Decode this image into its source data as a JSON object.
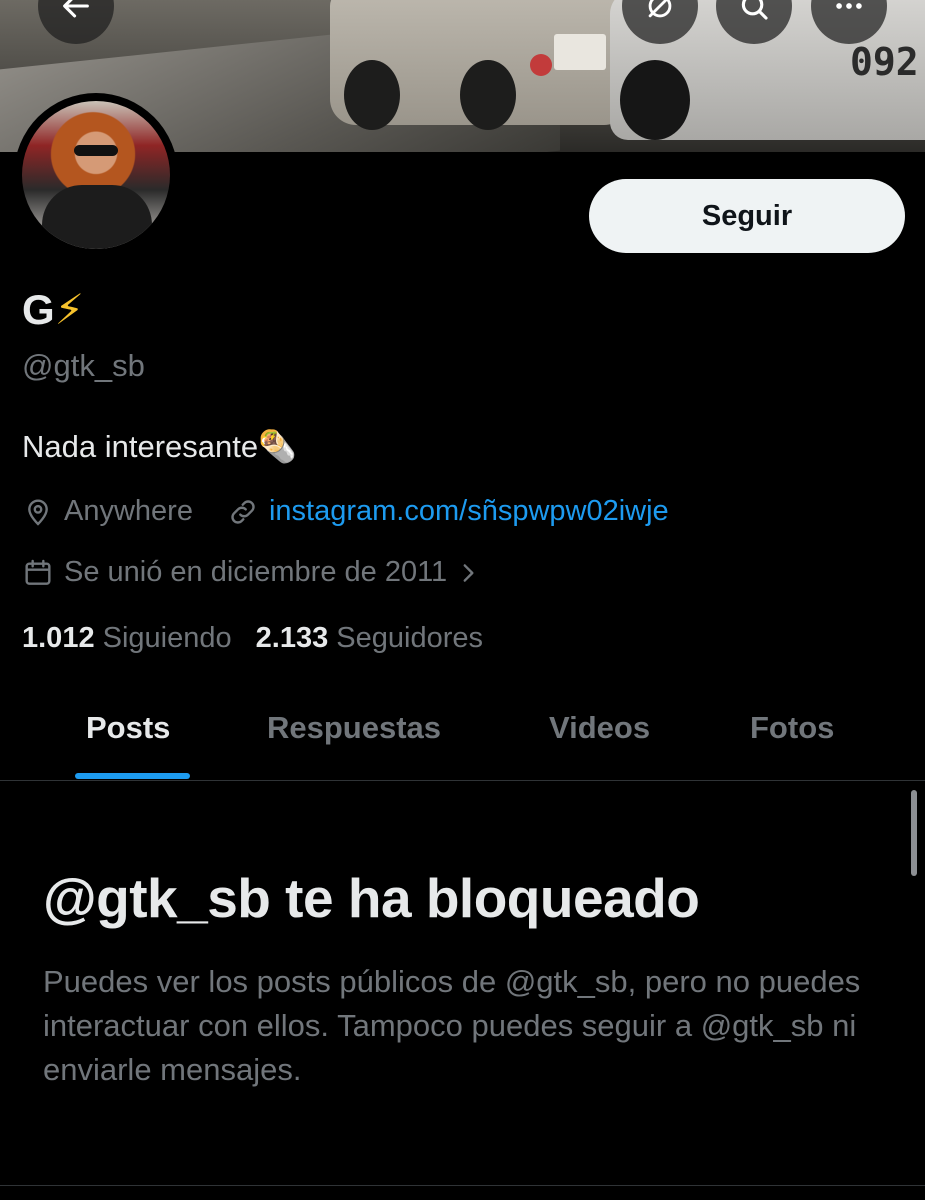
{
  "banner": {
    "van_number": "092"
  },
  "profile": {
    "display_name": "G",
    "display_emoji": "⚡",
    "handle": "@gtk_sb",
    "bio": "Nada interesante🌯",
    "location": "Anywhere",
    "website": "instagram.com/sñspwpw02iwje",
    "joined": "Se unió en diciembre de 2011"
  },
  "actions": {
    "follow_label": "Seguir"
  },
  "stats": {
    "following_count": "1.012",
    "following_label": "Siguiendo",
    "followers_count": "2.133",
    "followers_label": "Seguidores"
  },
  "tabs": [
    {
      "label": "Posts",
      "active": true
    },
    {
      "label": "Respuestas",
      "active": false
    },
    {
      "label": "Videos",
      "active": false
    },
    {
      "label": "Fotos",
      "active": false
    }
  ],
  "blocked": {
    "title": "@gtk_sb te ha bloqueado",
    "description": "Puedes ver los posts públicos de @gtk_sb, pero no puedes interactuar con ellos. Tampoco puedes seguir a @gtk_sb ni enviarle mensajes."
  },
  "icons": {
    "back": "arrow-left-icon",
    "grok": "grok-icon",
    "search": "search-icon",
    "more": "more-icon",
    "location": "location-pin-icon",
    "link": "link-icon",
    "calendar": "calendar-icon",
    "chevron": "chevron-right-icon"
  },
  "colors": {
    "accent": "#1d9bf0",
    "background": "#000000",
    "text_primary": "#e7e9ea",
    "text_secondary": "#71767b",
    "follow_button": "#eff3f4"
  }
}
